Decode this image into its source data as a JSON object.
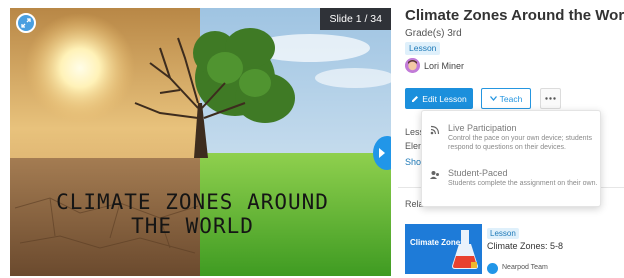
{
  "preview": {
    "slide_counter": "Slide 1 / 34",
    "title_line1": "CLIMATE ZONES AROUND",
    "title_line2": "THE WORLD",
    "expand_icon": "expand-icon",
    "next_icon": "chevron-right-icon"
  },
  "lesson": {
    "title": "Climate Zones Around the World",
    "grades": "Grade(s) 3rd",
    "type_badge": "Lesson",
    "author": "Lori Miner"
  },
  "actions": {
    "edit_label": "Edit Lesson",
    "teach_label": "Teach",
    "more_icon": "more-horizontal-icon"
  },
  "partial": {
    "lesson_label": "Less",
    "grade_label": "Elen",
    "show_link": "Sho",
    "related_label": "Rela"
  },
  "dropdown": {
    "items": [
      {
        "title": "Live Participation",
        "description": "Control the pace on your own device; students respond to questions on their devices.",
        "icon": "broadcast-icon"
      },
      {
        "title": "Student-Paced",
        "description": "Students complete the assignment on their own.",
        "icon": "student-icon"
      }
    ]
  },
  "related_card": {
    "thumb_text": "Climate Zones",
    "badge": "Lesson",
    "title": "Climate Zones: 5-8",
    "author": "Nearpod Team"
  },
  "colors": {
    "accent": "#1b8fdc",
    "badge_bg": "#dff0fb",
    "text_dark": "#333333"
  }
}
